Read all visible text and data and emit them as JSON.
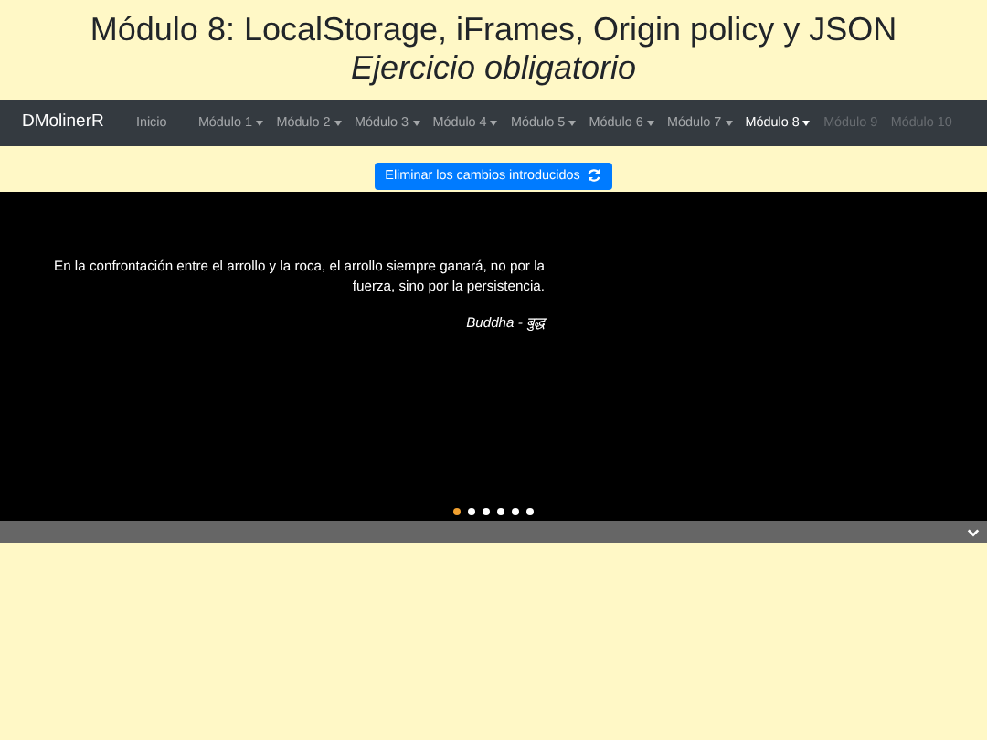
{
  "header": {
    "title": "Módulo 8: LocalStorage, iFrames, Origin policy y JSON",
    "subtitle": "Ejercicio obligatorio"
  },
  "navbar": {
    "brand": "DMolinerR",
    "items": [
      {
        "label": "Inicio",
        "kind": "link",
        "selected": false,
        "disabled": false
      },
      {
        "label": "Módulo 1",
        "kind": "dropdown",
        "selected": false,
        "disabled": false
      },
      {
        "label": "Módulo 2",
        "kind": "dropdown",
        "selected": false,
        "disabled": false
      },
      {
        "label": "Módulo 3",
        "kind": "dropdown",
        "selected": false,
        "disabled": false
      },
      {
        "label": "Módulo 4",
        "kind": "dropdown",
        "selected": false,
        "disabled": false
      },
      {
        "label": "Módulo 5",
        "kind": "dropdown",
        "selected": false,
        "disabled": false
      },
      {
        "label": "Módulo 6",
        "kind": "dropdown",
        "selected": false,
        "disabled": false
      },
      {
        "label": "Módulo 7",
        "kind": "dropdown",
        "selected": false,
        "disabled": false
      },
      {
        "label": "Módulo 8",
        "kind": "dropdown",
        "selected": true,
        "disabled": false
      },
      {
        "label": "Módulo 9",
        "kind": "link",
        "selected": false,
        "disabled": true
      },
      {
        "label": "Módulo 10",
        "kind": "link",
        "selected": false,
        "disabled": true
      }
    ]
  },
  "reset_button": {
    "label": "Eliminar los cambios introducidos"
  },
  "carousel": {
    "quote": "En la confrontación entre el arrollo y la roca, el arrollo siempre ganará, no por la fuerza, sino por la persistencia.",
    "author": "Buddha - बुद्ध",
    "indicators": [
      {
        "selected": true
      },
      {
        "selected": false
      },
      {
        "selected": false
      },
      {
        "selected": false
      },
      {
        "selected": false
      },
      {
        "selected": false
      }
    ]
  }
}
